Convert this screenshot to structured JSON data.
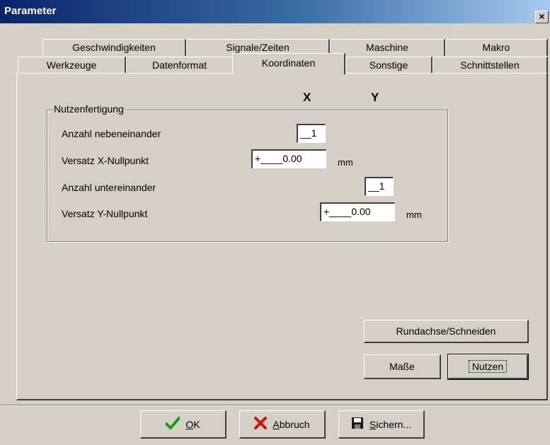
{
  "window": {
    "title": "Parameter",
    "close_glyph": "×"
  },
  "tabs_row1": [
    "Geschwindigkeiten",
    "Signale/Zeiten",
    "Maschine",
    "Makro"
  ],
  "tabs_row2": [
    "Werkzeuge",
    "Datenformat",
    "Koordinaten",
    "Sonstige",
    "Schnittstellen"
  ],
  "active_tab": "Koordinaten",
  "axes": {
    "x": "X",
    "y": "Y"
  },
  "group": {
    "title": "Nutzenfertigung",
    "rows": [
      {
        "label": "Anzahl nebeneinander",
        "value": "__1"
      },
      {
        "label": "Versatz X-Nullpunkt",
        "value": "+____0.00",
        "unit": "mm"
      },
      {
        "label": "Anzahl untereinander",
        "value": "__1"
      },
      {
        "label": "Versatz Y-Nullpunkt",
        "value": "+____0.00",
        "unit": "mm"
      }
    ]
  },
  "buttons": {
    "rundachse": "Rundachse/Schneiden",
    "masse": "Maße",
    "nutzen": "Nutzen"
  },
  "footer": {
    "ok_prefix": "",
    "ok_ul": "O",
    "ok_rest": "K",
    "abbruch_ul": "A",
    "abbruch_rest": "bbruch",
    "sichern_ul": "S",
    "sichern_rest": "ichern..."
  },
  "colors": {
    "ok_check": "#1a9a1a",
    "cancel_x": "#d01010"
  }
}
